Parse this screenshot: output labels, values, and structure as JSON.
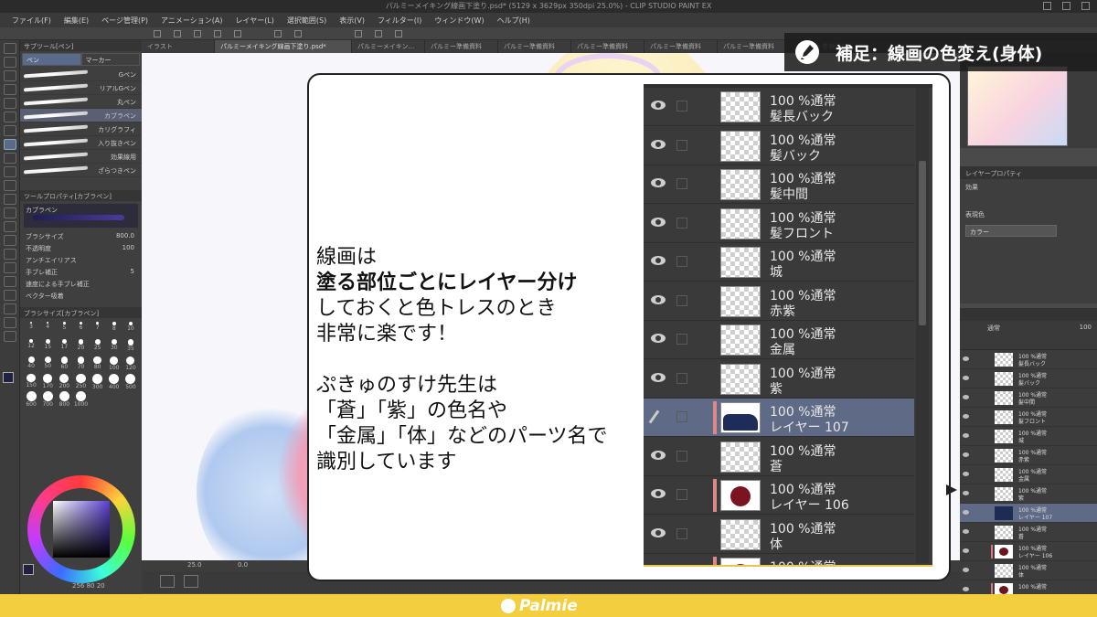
{
  "window": {
    "title": "パルミーメイキング線画下塗り.psd* (5129 x 3629px 350dpi 25.0%) - CLIP STUDIO PAINT EX"
  },
  "menu": [
    "ファイル(F)",
    "編集(E)",
    "ページ管理(P)",
    "アニメーション(A)",
    "レイヤー(L)",
    "選択範囲(S)",
    "表示(V)",
    "フィルター(I)",
    "ウィンドウ(W)",
    "ヘルプ(H)"
  ],
  "tabs": [
    {
      "label": "イラスト",
      "active": false
    },
    {
      "label": "パルミーメイキング線画下塗り.psd*",
      "active": true
    },
    {
      "label": "パルミーメイキン...",
      "active": false
    },
    {
      "label": "パルミー準備資料",
      "active": false
    },
    {
      "label": "パルミー準備資料",
      "active": false
    },
    {
      "label": "パルミー準備資料",
      "active": false
    },
    {
      "label": "パルミー準備資料",
      "active": false
    },
    {
      "label": "パルミー準備資料",
      "active": false
    },
    {
      "label": "パルミー準備資料",
      "active": false
    }
  ],
  "subtool": {
    "panel_title": "サブツール[ペン]",
    "tab_pen": "ペン",
    "tab_marker": "マーカー",
    "pens": [
      {
        "label": "Gペン",
        "selected": false
      },
      {
        "label": "リアルGペン",
        "selected": false
      },
      {
        "label": "丸ペン",
        "selected": false
      },
      {
        "label": "カブラペン",
        "selected": true
      },
      {
        "label": "カリグラフィ",
        "selected": false
      },
      {
        "label": "入り抜きペン",
        "selected": false
      },
      {
        "label": "効果線用",
        "selected": false
      },
      {
        "label": "ざらつきペン",
        "selected": false
      }
    ]
  },
  "toolprop": {
    "title": "ツールプロパティ[カブラペン]",
    "preset": "カブラペン",
    "rows": [
      {
        "label": "ブラシサイズ",
        "value": "800.0"
      },
      {
        "label": "不透明度",
        "value": "100"
      },
      {
        "label": "アンチエイリアス",
        "value": ""
      },
      {
        "label": "手ブレ補正",
        "value": "5"
      },
      {
        "label": "速度による手ブレ補正",
        "value": ""
      },
      {
        "label": "ベクター吸着",
        "value": ""
      }
    ]
  },
  "brushsize": {
    "title": "ブラシサイズ[カブラペン]",
    "sizes": [
      "3",
      "4",
      "5",
      "6",
      "7",
      "8",
      "10",
      "12",
      "15",
      "17",
      "20",
      "25",
      "30",
      "35",
      "40",
      "50",
      "60",
      "70",
      "80",
      "100",
      "120",
      "150",
      "170",
      "200",
      "250",
      "300",
      "400",
      "500",
      "600",
      "700",
      "800",
      "1000"
    ]
  },
  "status": {
    "zoom": "25.0",
    "angle": "0.0",
    "info": "256 80 20"
  },
  "overlay": {
    "heading": "補足：線画の色変え(身体)",
    "lines": [
      {
        "text": "線画は",
        "bold": false
      },
      {
        "text": "塗る部位ごとにレイヤー分け",
        "bold": true
      },
      {
        "text": "しておくと色トレスのとき",
        "bold": false
      },
      {
        "text": "非常に楽です！",
        "bold": false
      },
      {
        "text": "",
        "bold": false
      },
      {
        "text": "ぷきゅのすけ先生は",
        "bold": false
      },
      {
        "text": "「蒼」「紫」の色名や",
        "bold": false
      },
      {
        "text": "「金属」「体」などのパーツ名で",
        "bold": false
      },
      {
        "text": "識別しています",
        "bold": false
      }
    ]
  },
  "zoomed_layers": [
    {
      "mode": "100 %通常",
      "name": "髪長バック",
      "thumb": "empty",
      "selected": false,
      "marker": false,
      "icon": "eye"
    },
    {
      "mode": "100 %通常",
      "name": "髪バック",
      "thumb": "empty",
      "selected": false,
      "marker": false,
      "icon": "eye"
    },
    {
      "mode": "100 %通常",
      "name": "髪中間",
      "thumb": "empty",
      "selected": false,
      "marker": false,
      "icon": "eye"
    },
    {
      "mode": "100 %通常",
      "name": "髪フロント",
      "thumb": "empty",
      "selected": false,
      "marker": false,
      "icon": "eye"
    },
    {
      "mode": "100 %通常",
      "name": "城",
      "thumb": "empty",
      "selected": false,
      "marker": false,
      "icon": "eye"
    },
    {
      "mode": "100 %通常",
      "name": "赤紫",
      "thumb": "empty",
      "selected": false,
      "marker": false,
      "icon": "eye"
    },
    {
      "mode": "100 %通常",
      "name": "金属",
      "thumb": "empty",
      "selected": false,
      "marker": false,
      "icon": "eye"
    },
    {
      "mode": "100 %通常",
      "name": "紫",
      "thumb": "empty",
      "selected": false,
      "marker": false,
      "icon": "eye"
    },
    {
      "mode": "100 %通常",
      "name": "レイヤー 107",
      "thumb": "dark",
      "selected": true,
      "marker": true,
      "icon": "pen"
    },
    {
      "mode": "100 %通常",
      "name": "蒼",
      "thumb": "empty",
      "selected": false,
      "marker": false,
      "icon": "eye"
    },
    {
      "mode": "100 %通常",
      "name": "レイヤー 106",
      "thumb": "red",
      "selected": false,
      "marker": true,
      "icon": "eye"
    },
    {
      "mode": "100 %通常",
      "name": "体",
      "thumb": "empty",
      "selected": false,
      "marker": false,
      "icon": "eye"
    },
    {
      "mode": "100 %通常",
      "name": "",
      "thumb": "red",
      "selected": false,
      "marker": true,
      "icon": "eye"
    }
  ],
  "layer_property": {
    "title": "レイヤープロパティ",
    "effect_label": "効果",
    "color_label": "表現色",
    "color_value": "カラー"
  },
  "layer_panel": {
    "blend_mode": "通常",
    "opacity": "100",
    "layers": [
      {
        "mode": "100 %通常",
        "name": "髪長バック",
        "thumb": "empty",
        "selected": false,
        "marker": false
      },
      {
        "mode": "100 %通常",
        "name": "髪バック",
        "thumb": "empty",
        "selected": false,
        "marker": false
      },
      {
        "mode": "100 %通常",
        "name": "髪中間",
        "thumb": "empty",
        "selected": false,
        "marker": false
      },
      {
        "mode": "100 %通常",
        "name": "髪フロント",
        "thumb": "empty",
        "selected": false,
        "marker": false
      },
      {
        "mode": "100 %通常",
        "name": "城",
        "thumb": "empty",
        "selected": false,
        "marker": false
      },
      {
        "mode": "100 %通常",
        "name": "赤紫",
        "thumb": "empty",
        "selected": false,
        "marker": false
      },
      {
        "mode": "100 %通常",
        "name": "金属",
        "thumb": "empty",
        "selected": false,
        "marker": false
      },
      {
        "mode": "100 %通常",
        "name": "紫",
        "thumb": "empty",
        "selected": false,
        "marker": false
      },
      {
        "mode": "100 %通常",
        "name": "レイヤー 107",
        "thumb": "dark",
        "selected": true,
        "marker": false
      },
      {
        "mode": "100 %通常",
        "name": "蒼",
        "thumb": "empty",
        "selected": false,
        "marker": false
      },
      {
        "mode": "100 %通常",
        "name": "レイヤー 106",
        "thumb": "red",
        "selected": false,
        "marker": true
      },
      {
        "mode": "100 %通常",
        "name": "体",
        "thumb": "empty",
        "selected": false,
        "marker": false
      },
      {
        "mode": "100 %通常",
        "name": "",
        "thumb": "red",
        "selected": false,
        "marker": true
      }
    ]
  },
  "brand": {
    "name": "Palmie",
    "bar_color": "#f3cf3f"
  }
}
